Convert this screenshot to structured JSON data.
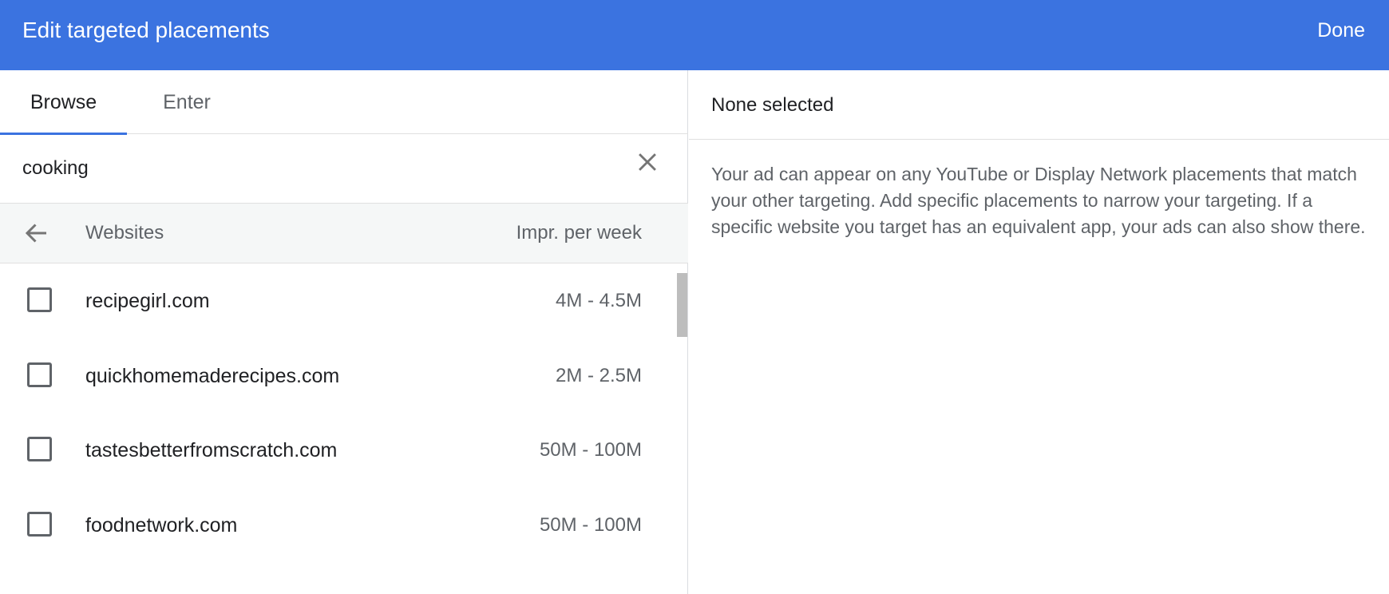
{
  "header": {
    "title": "Edit targeted placements",
    "done_label": "Done"
  },
  "tabs": [
    {
      "label": "Browse",
      "active": true
    },
    {
      "label": "Enter",
      "active": false
    }
  ],
  "search": {
    "value": "cooking"
  },
  "list_header": {
    "websites_label": "Websites",
    "impressions_label": "Impr. per week"
  },
  "placements": [
    {
      "site": "recipegirl.com",
      "impressions": "4M - 4.5M"
    },
    {
      "site": "quickhomemaderecipes.com",
      "impressions": "2M - 2.5M"
    },
    {
      "site": "tastesbetterfromscratch.com",
      "impressions": "50M - 100M"
    },
    {
      "site": "foodnetwork.com",
      "impressions": "50M - 100M"
    }
  ],
  "selection": {
    "status": "None selected",
    "info": "Your ad can appear on any YouTube or Display Network placements that match your other targeting. Add specific placements to narrow your targeting. If a specific website you target has an equivalent app, your ads can also show there."
  },
  "colors": {
    "accent": "#3b73e0",
    "header_bg": "#3b73e0",
    "list_header_bg": "#f5f7f7"
  },
  "icons": {
    "clear": "close-icon",
    "back": "arrow-back-icon",
    "checkbox": "checkbox-unchecked-icon"
  }
}
